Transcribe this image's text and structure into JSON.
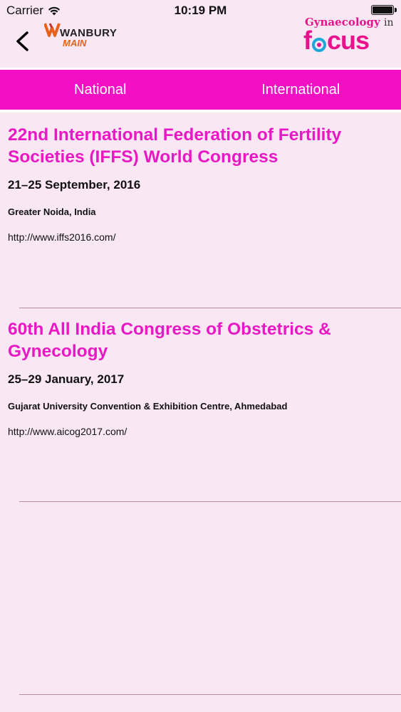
{
  "status_bar": {
    "carrier": "Carrier",
    "time": "10:19 PM"
  },
  "header": {
    "brand_left_top": "WANBURY",
    "brand_left_bottom": "MAIN",
    "brand_right_top": "Gynaecology",
    "brand_right_in": "in",
    "brand_right_bottom_f": "f",
    "brand_right_bottom_rest": "cus"
  },
  "tabs": [
    {
      "label": "National"
    },
    {
      "label": "International"
    }
  ],
  "events": [
    {
      "title": "22nd International Federation of Fertility Societies (IFFS) World Congress",
      "date": "21–25 September, 2016",
      "venue": "Greater Noida, India",
      "link": "http://www.iffs2016.com/"
    },
    {
      "title": "60th All India Congress of Obstetrics & Gynecology",
      "date": "25–29 January, 2017",
      "venue": "Gujarat University Convention & Exhibition Centre, Ahmedabad",
      "link": "http://www.aicog2017.com/"
    }
  ],
  "colors": {
    "accent": "#f20fc4",
    "title": "#e818c4",
    "background": "#f9e7f3"
  }
}
